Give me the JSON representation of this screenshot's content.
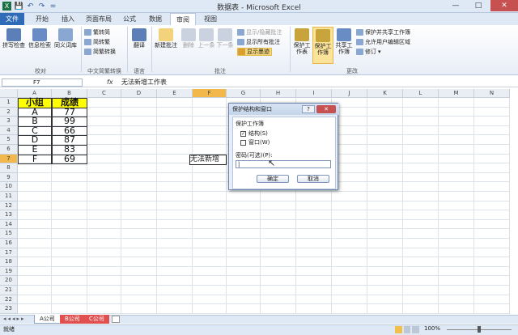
{
  "window": {
    "title": "数据表 - Microsoft Excel",
    "controls": {
      "help": "?",
      "minimize": "—",
      "maximize": "□",
      "close": "✕"
    }
  },
  "quick_access": {
    "save": "💾",
    "undo": "↶",
    "redo": "↷",
    "customize": "="
  },
  "tabs": [
    "文件",
    "开始",
    "插入",
    "页面布局",
    "公式",
    "数据",
    "审阅",
    "视图"
  ],
  "ribbon": {
    "proofing": {
      "spell": "拼写检查",
      "research": "信息检索",
      "thesaurus": "同义词库",
      "label": "校对"
    },
    "chinese": {
      "to_simplified": "繁转简",
      "to_traditional": "简转繁",
      "convert": "简繁转换",
      "label": "中文简繁转换"
    },
    "language": {
      "translate": "翻译",
      "label": "语言"
    },
    "comments": {
      "new": "新建批注",
      "delete": "删除",
      "prev": "上一条",
      "next": "下一条",
      "show_hide": "显示/隐藏批注",
      "show_all": "显示所有批注",
      "show_ink": "显示墨迹",
      "label": "批注"
    },
    "changes": {
      "protect_sheet": "保护工作表",
      "protect_workbook": "保护工作簿",
      "share_workbook": "共享工作簿",
      "protect_share": "保护并共享工作簿",
      "allow_edit": "允许用户编辑区域",
      "track": "修订",
      "label": "更改"
    }
  },
  "formula_bar": {
    "name_box": "F7",
    "fx": "fx",
    "formula": "无法新增工作表"
  },
  "columns": [
    "A",
    "B",
    "C",
    "D",
    "E",
    "F",
    "G",
    "H",
    "I",
    "J",
    "K",
    "L",
    "M",
    "N"
  ],
  "rows": [
    "1",
    "2",
    "3",
    "4",
    "5",
    "6",
    "7",
    "8",
    "9",
    "10",
    "11",
    "12",
    "13",
    "14",
    "15",
    "16",
    "17",
    "18",
    "19",
    "20",
    "21",
    "22",
    "23"
  ],
  "table": {
    "headers": [
      "小组",
      "成绩"
    ],
    "rows": [
      [
        "A",
        "77"
      ],
      [
        "B",
        "99"
      ],
      [
        "C",
        "66"
      ],
      [
        "D",
        "87"
      ],
      [
        "E",
        "83"
      ],
      [
        "F",
        "69"
      ]
    ]
  },
  "cell_text": "无法新增",
  "sheet_tabs": [
    "A公司",
    "B公司",
    "C公司"
  ],
  "status": {
    "ready": "就绪",
    "zoom": "100%"
  },
  "dialog": {
    "title": "保护结构和窗口",
    "help": "?",
    "close": "✕",
    "section": "保护工作簿",
    "structure": "结构(S)",
    "windows": "窗口(W)",
    "password_label": "密码(可选)(P):",
    "ok": "确定",
    "cancel": "取消"
  },
  "colors": {
    "accent": "#2f6bb7",
    "header_fill": "#ffff00",
    "active": "#f2b84b"
  }
}
